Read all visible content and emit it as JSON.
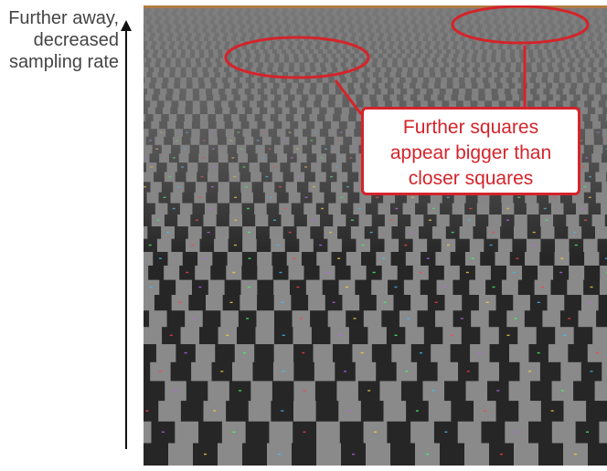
{
  "side_label": {
    "line1": "Further away,",
    "line2": "decreased",
    "line3": "sampling rate"
  },
  "callout": {
    "line1": "Further squares",
    "line2": "appear bigger than",
    "line3": "closer squares"
  },
  "colors": {
    "accent_red": "#d4242a",
    "dark_tile": "#262626",
    "light_tile": "#8a8a8a",
    "side_text": "#444444",
    "arrow": "#111111"
  },
  "icons": [
    "up-arrow-icon"
  ]
}
